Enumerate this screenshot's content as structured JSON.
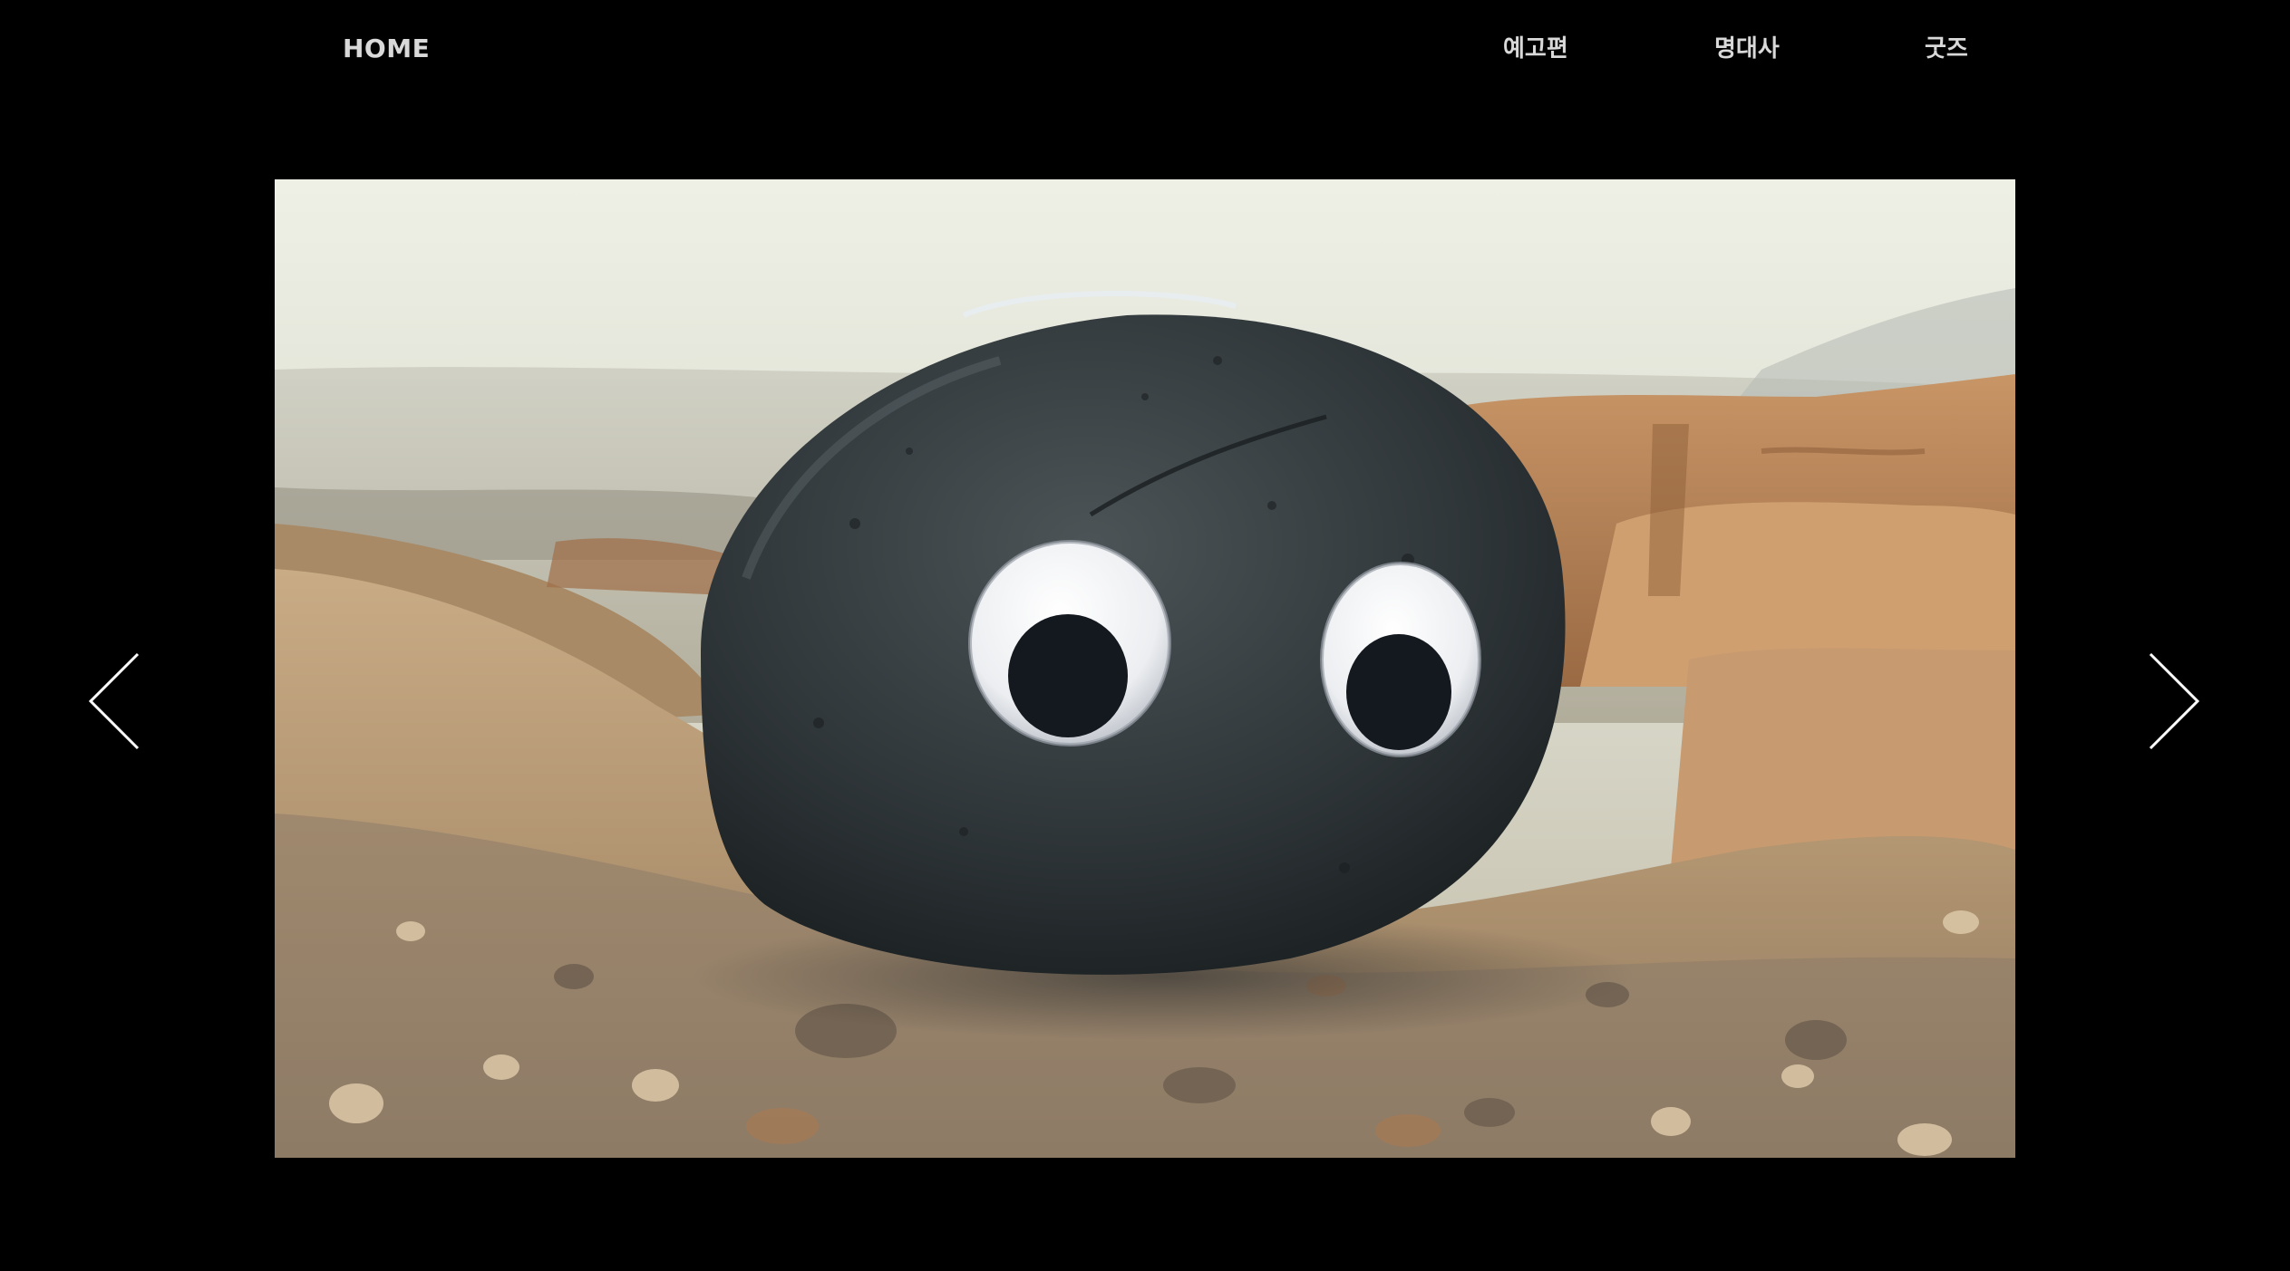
{
  "nav": {
    "home_label": "HOME",
    "links": [
      {
        "label": "예고편"
      },
      {
        "label": "명대사"
      },
      {
        "label": "굿즈"
      }
    ]
  },
  "slider": {
    "prev_icon": "chevron-left-icon",
    "next_icon": "chevron-right-icon"
  },
  "colors": {
    "background": "#000000",
    "nav_text": "#d9d9d9"
  }
}
